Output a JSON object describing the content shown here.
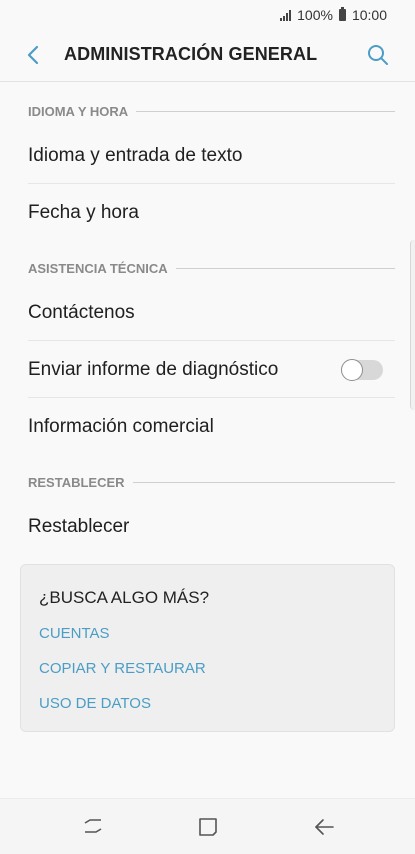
{
  "status_bar": {
    "battery_percent": "100%",
    "time": "10:00"
  },
  "header": {
    "title": "ADMINISTRACIÓN GENERAL",
    "back_icon": "chevron-left-icon",
    "search_icon": "search-icon"
  },
  "sections": [
    {
      "header": "IDIOMA Y HORA",
      "items": [
        {
          "label": "Idioma y entrada de texto"
        },
        {
          "label": "Fecha y hora"
        }
      ]
    },
    {
      "header": "ASISTENCIA TÉCNICA",
      "items": [
        {
          "label": "Contáctenos"
        },
        {
          "label": "Enviar informe de diagnóstico",
          "toggle": false
        },
        {
          "label": "Información comercial"
        }
      ]
    },
    {
      "header": "RESTABLECER",
      "items": [
        {
          "label": "Restablecer"
        }
      ]
    }
  ],
  "suggestions": {
    "title": "¿BUSCA ALGO MÁS?",
    "links": [
      "CUENTAS",
      "COPIAR Y RESTAURAR",
      "USO DE DATOS"
    ]
  },
  "nav_bar": {
    "recent_icon": "recent-apps-icon",
    "home_icon": "home-icon",
    "back_icon": "back-arrow-icon"
  },
  "colors": {
    "accent": "#4b9dc5",
    "background": "#f9f9f9",
    "section_label": "#8a8a8a"
  }
}
